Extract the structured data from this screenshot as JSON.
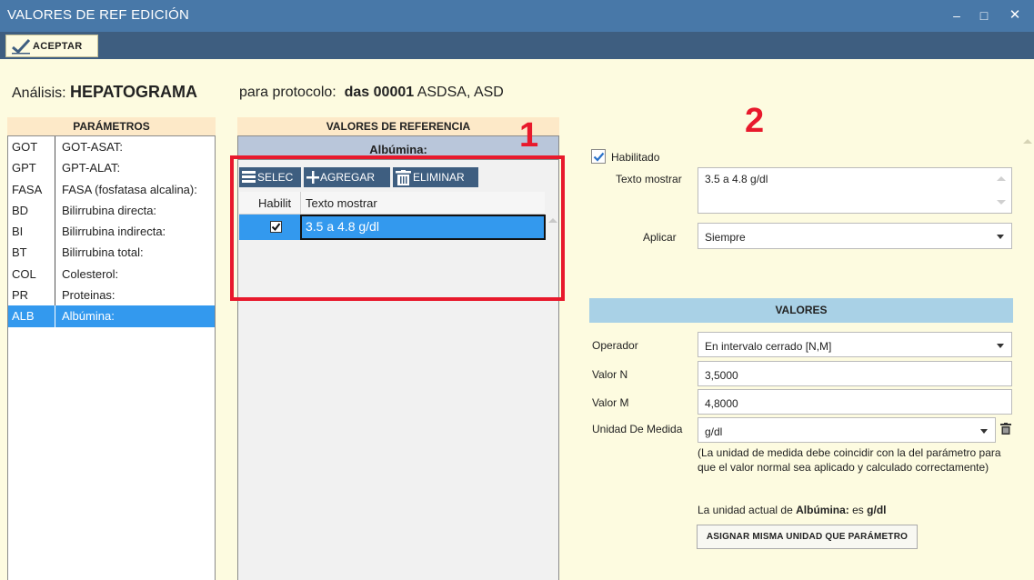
{
  "window": {
    "title": "VALORES DE REF EDICIÓN",
    "min": "–",
    "max": "□",
    "close": "✕"
  },
  "toolbar": {
    "aceptar_label": "ACEPTAR"
  },
  "header": {
    "analisis_label": "Análisis:",
    "analisis_value": "HEPATOGRAMA",
    "protocolo_label": "para protocolo:",
    "protocolo_value": "das 00001",
    "protocolo_extra": "ASDSA, ASD"
  },
  "parametros": {
    "title": "PARÁMETROS",
    "items": [
      {
        "code": "GOT",
        "name": "GOT-ASAT:"
      },
      {
        "code": "GPT",
        "name": "GPT-ALAT:"
      },
      {
        "code": "FASA",
        "name": "FASA (fosfatasa alcalina):"
      },
      {
        "code": "BD",
        "name": "Bilirrubina directa:"
      },
      {
        "code": "BI",
        "name": "Bilirrubina indirecta:"
      },
      {
        "code": "BT",
        "name": "Bilirrubina total:"
      },
      {
        "code": "COL",
        "name": "Colesterol:"
      },
      {
        "code": "PR",
        "name": "Proteinas:"
      },
      {
        "code": "ALB",
        "name": "Albúmina:"
      }
    ]
  },
  "valores_ref": {
    "title": "VALORES DE REFERENCIA",
    "subtitle": "Albúmina:",
    "buttons": {
      "selec": "SELEC",
      "agregar": "AGREGAR",
      "eliminar": "ELIMINAR"
    },
    "grid": {
      "col_habilit": "Habilit",
      "col_texto": "Texto mostrar",
      "rows": [
        {
          "habilitado": true,
          "texto": "3.5 a 4.8 g/dl"
        }
      ]
    }
  },
  "annotations": {
    "one": "1",
    "two": "2"
  },
  "detalle": {
    "habilitado_label": "Habilitado",
    "texto_mostrar_label": "Texto mostrar",
    "texto_mostrar_value": "3.5 a 4.8 g/dl",
    "aplicar_label": "Aplicar",
    "aplicar_value": "Siempre"
  },
  "valores": {
    "title": "VALORES",
    "operador_label": "Operador",
    "operador_value": "En intervalo cerrado [N,M]",
    "valor_n_label": "Valor N",
    "valor_n_value": "3,5000",
    "valor_m_label": "Valor M",
    "valor_m_value": "4,8000",
    "unidad_label": "Unidad De Medida",
    "unidad_value": "g/dl",
    "note": "(La unidad de medida debe coincidir con la del parámetro para que el valor normal sea aplicado y calculado correctamente)",
    "actual_prefix": "La unidad actual de",
    "actual_param": "Albúmina:",
    "actual_mid": "es",
    "actual_unit": "g/dl",
    "asignar_label": "ASIGNAR MISMA UNIDAD QUE PARÁMETRO"
  },
  "colors": {
    "titlebar": "#4878a8",
    "toolbar": "#3e5e80",
    "selection": "#3399ee",
    "annotation": "#e8192c",
    "background": "#fdfbe0"
  }
}
